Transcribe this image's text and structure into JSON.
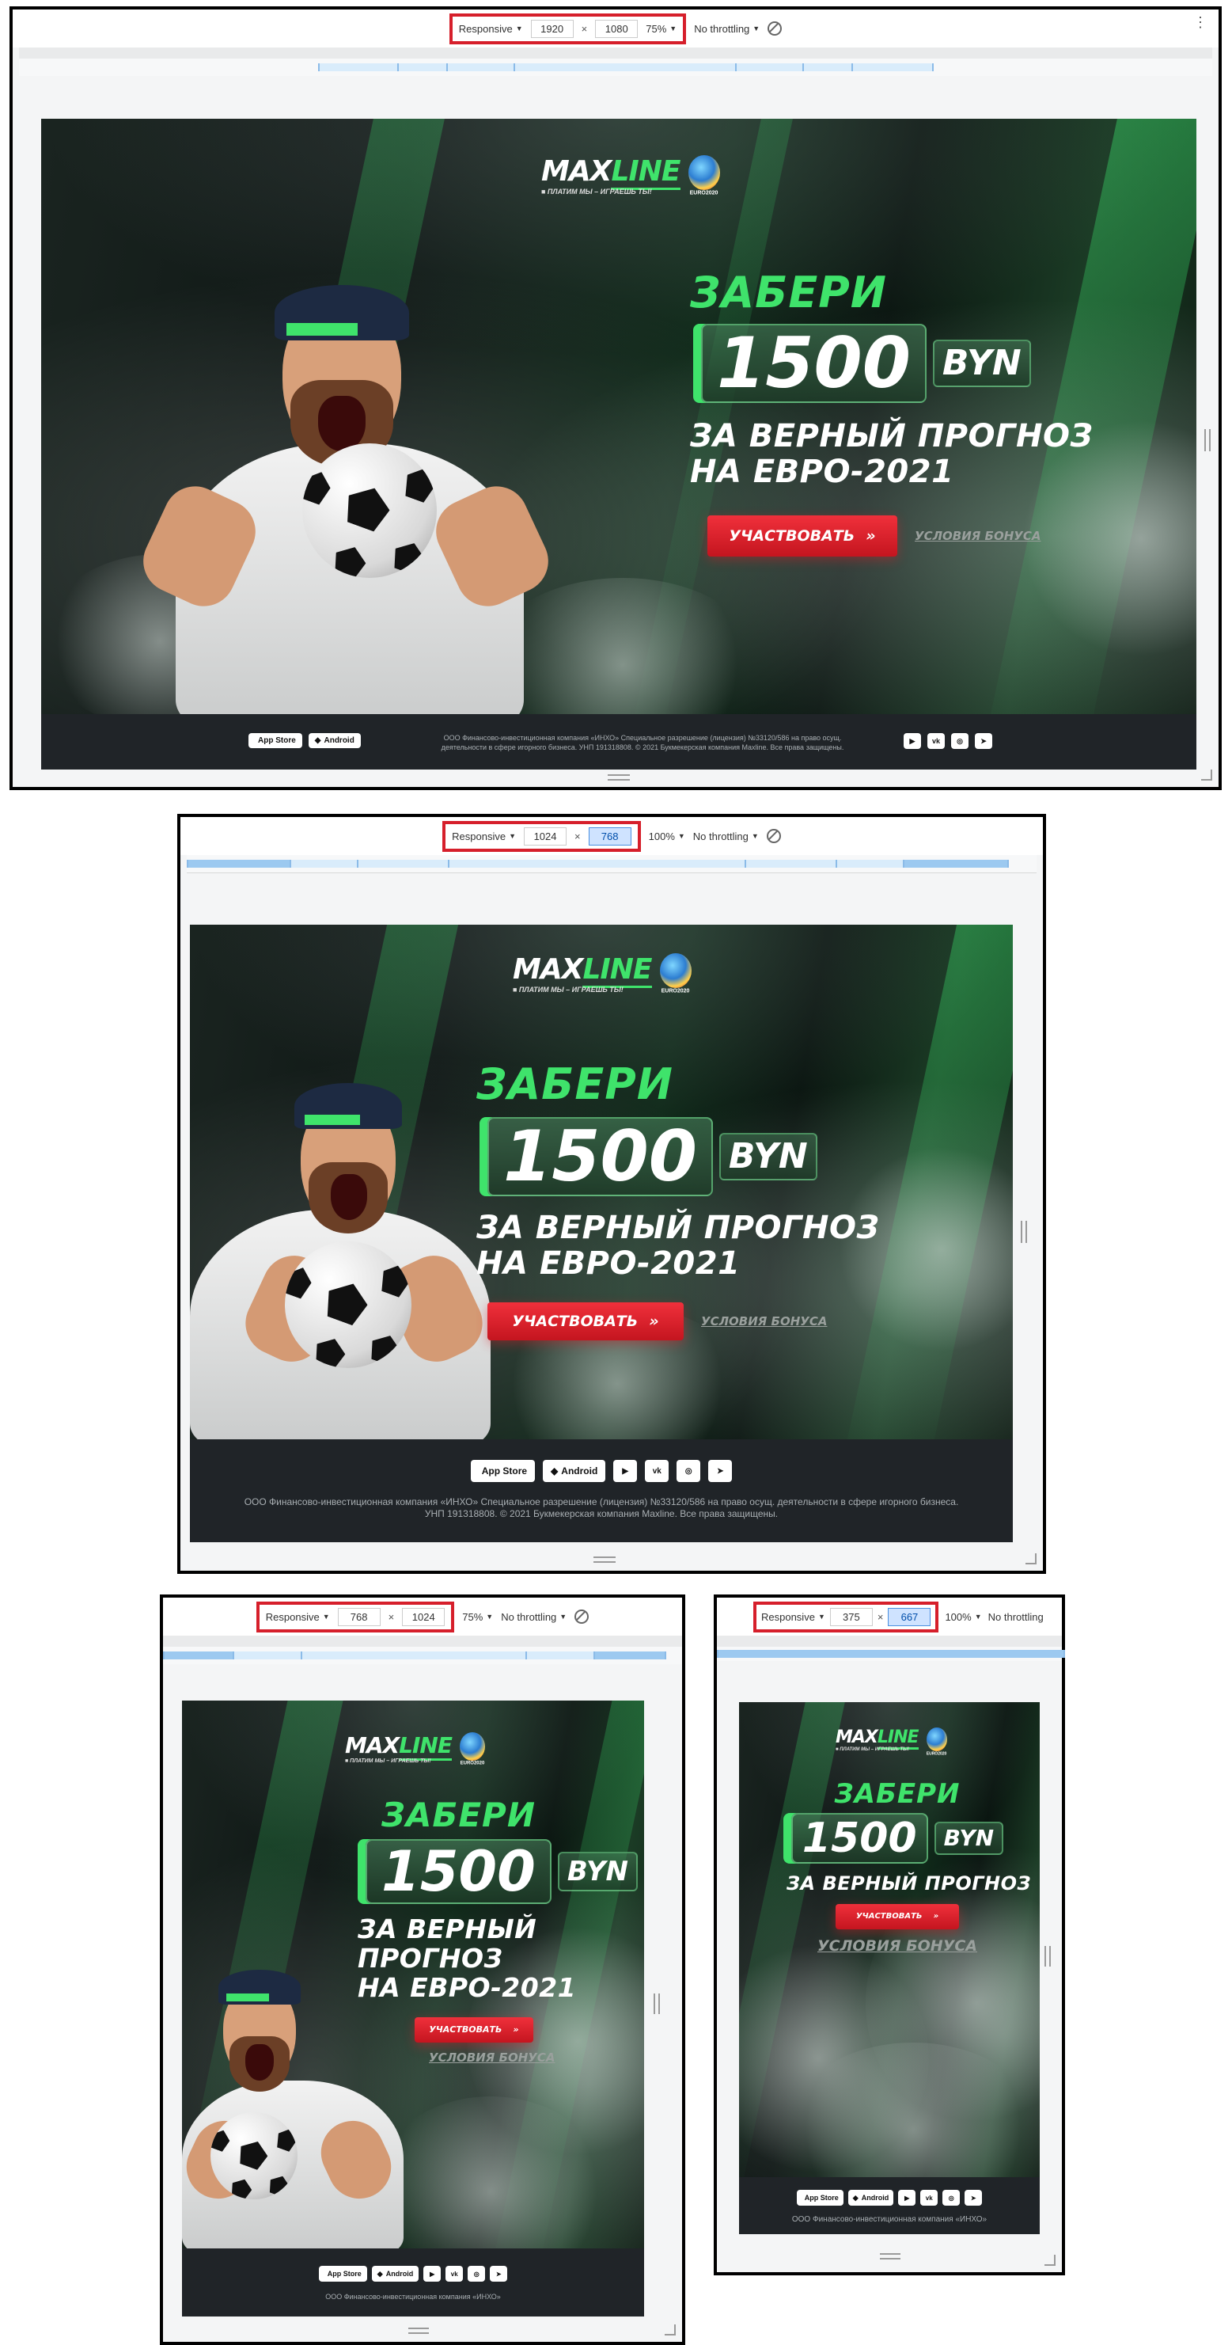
{
  "devtools": {
    "device_mode": "Responsive",
    "throttling": "No throttling",
    "dim_separator": "×"
  },
  "frames": [
    {
      "width": "1920",
      "height": "1080",
      "zoom": "75%"
    },
    {
      "width": "1024",
      "height": "768",
      "zoom": "100%"
    },
    {
      "width": "768",
      "height": "1024",
      "zoom": "75%"
    },
    {
      "width": "375",
      "height": "667",
      "zoom": "100%"
    }
  ],
  "banner": {
    "brand_max": "MAX",
    "brand_line": "LINE",
    "brand_tagline": "■ ПЛАТИМ МЫ – ИГРАЕШЬ ТЫ!",
    "euro_label": "EURO2020",
    "headline": "ЗАБЕРИ",
    "amount": "1500",
    "currency": "BYN",
    "subtitle_line1": "ЗА ВЕРНЫЙ ПРОГНОЗ",
    "subtitle_line2": "НА ЕВРО-2021",
    "subtitle_short": "ЗА ВЕРНЫЙ ПРОГНОЗ",
    "cta_label": "УЧАСТВОВАТЬ",
    "cta_arrow": "»",
    "terms_label": "УСЛОВИЯ БОНУСА"
  },
  "footer": {
    "app_store": "App Store",
    "android": "Android",
    "apple_glyph": "",
    "android_glyph": "◆",
    "social": [
      "▶",
      "vk",
      "◎",
      "➤"
    ],
    "legal_line1": "ООО Финансово-инвестиционная компания «ИНХО» Специальное разрешение (лицензия) №33120/586 на право осущ. деятельности в сфере игорного бизнеса.",
    "legal_line2": "УНП 191318808. © 2021 Букмекерская компания Maxline. Все права защищены.",
    "legal_wide_line1": "ООО Финансово-инвестиционная компания «ИНХО» Специальное разрешение (лицензия) №33120/586 на право осущ.",
    "legal_wide_line2": "деятельности в сфере игорного бизнеса. УНП 191318808. © 2021 Букмекерская компания Maxline. Все права защищены.",
    "legal_short": "ООО Финансово-инвестиционная компания «ИНХО»"
  }
}
